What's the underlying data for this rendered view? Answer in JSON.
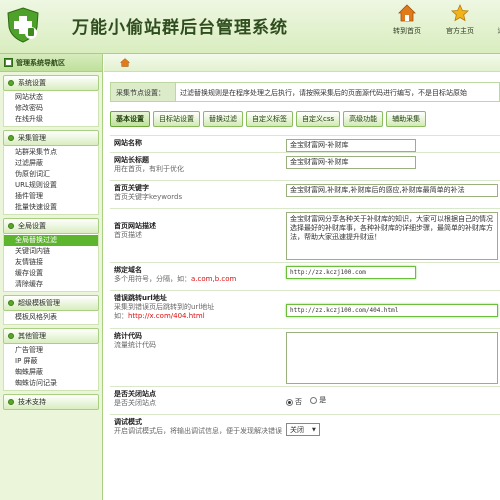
{
  "app": {
    "title": "万能小偷站群后台管理系统"
  },
  "top_nav": [
    {
      "label": "转到首页",
      "icon": "home-icon"
    },
    {
      "label": "官方主页",
      "icon": "star-icon"
    },
    {
      "label": "退",
      "icon": "exit-icon"
    }
  ],
  "sidebar": {
    "title": "管理系统导航区",
    "groups": [
      {
        "title": "系统设置",
        "items": [
          {
            "label": "网站状态",
            "active": false
          },
          {
            "label": "修改密码",
            "active": false
          },
          {
            "label": "在线升级",
            "active": false
          }
        ]
      },
      {
        "title": "采集管理",
        "items": [
          {
            "label": "站群采集节点",
            "active": false
          },
          {
            "label": "过滤屏蔽",
            "active": false
          },
          {
            "label": "伪原创词汇",
            "active": false
          },
          {
            "label": "URL规则设置",
            "active": false
          },
          {
            "label": "插件管理",
            "active": false
          },
          {
            "label": "批量快速设置",
            "active": false
          }
        ]
      },
      {
        "title": "全局设置",
        "items": [
          {
            "label": "全局替换过滤",
            "active": true
          },
          {
            "label": "关键词内链",
            "active": false
          },
          {
            "label": "友情链接",
            "active": false
          },
          {
            "label": "缓存设置",
            "active": false
          },
          {
            "label": "清除缓存",
            "active": false
          }
        ]
      },
      {
        "title": "超级模板管理",
        "items": [
          {
            "label": "模板风格列表",
            "active": false
          }
        ]
      },
      {
        "title": "其他管理",
        "items": [
          {
            "label": "广告管理",
            "active": false
          },
          {
            "label": "IP 屏蔽",
            "active": false
          },
          {
            "label": "蜘蛛屏蔽",
            "active": false
          },
          {
            "label": "蜘蛛访问记录",
            "active": false
          }
        ]
      },
      {
        "title": "技术支持",
        "items": []
      }
    ]
  },
  "main": {
    "info": {
      "label": "采集节点设置：",
      "text": "过滤替换规则是在程序处理之后执行，请按照采集后的页面源代码进行编写，不是目标站原始"
    },
    "tabs": [
      {
        "label": "基本设置",
        "selected": true
      },
      {
        "label": "目标站设置",
        "selected": false
      },
      {
        "label": "替换过滤",
        "selected": false
      },
      {
        "label": "自定义标签",
        "selected": false
      },
      {
        "label": "自定义css",
        "selected": false
      },
      {
        "label": "高级功能",
        "selected": false
      },
      {
        "label": "辅助采集",
        "selected": false
      }
    ],
    "form": {
      "site_name": {
        "label": "网站名称",
        "value": "金宝财富网-补财库"
      },
      "site_subtitle": {
        "label": "网站长标题",
        "hint": "用在首页，有利于优化",
        "value": "金宝财富网-补财库"
      },
      "keywords": {
        "label": "首页关键字",
        "hint": "首页关键字keywords",
        "value": "金宝财富网,补财库,补财库后的感应,补财库最简单的补法"
      },
      "description": {
        "label": "首页网站描述",
        "hint": "首页描述",
        "value": "金宝财富网分享各种关于补财库的知识，大家可以根据自己的情况选择最好的补财库事，各种补财库的详细步骤，最简单的补财库方法，帮助大家迅速提升财运！"
      },
      "domain": {
        "label": "绑定域名",
        "hint_prefix": "多个用符号，分隔，如：",
        "hint_example": "a.com,b.com",
        "value": "http://zz.kczj100.com"
      },
      "error_url": {
        "label": "错误跳转url地址",
        "hint": "采集到错误页后跳转到的url地址",
        "hint_prefix": "如：",
        "hint_example": "http://x.com/404.html",
        "value": "http://zz.kczj100.com/404.html"
      },
      "stats": {
        "label": "统计代码",
        "hint": "流量统计代码",
        "value": ""
      },
      "site_close": {
        "label": "是否关闭站点",
        "hint": "是否关闭站点",
        "options": [
          "否",
          "是"
        ],
        "selected": "否"
      },
      "debug": {
        "label": "调试模式",
        "hint": "开启调试模式后，将输出调试信息，便于发现解决错误",
        "value": "关闭"
      }
    }
  },
  "colors": {
    "accent": "#5cb52c",
    "header_bg": "#d9edbf",
    "border": "#a9cf80"
  }
}
